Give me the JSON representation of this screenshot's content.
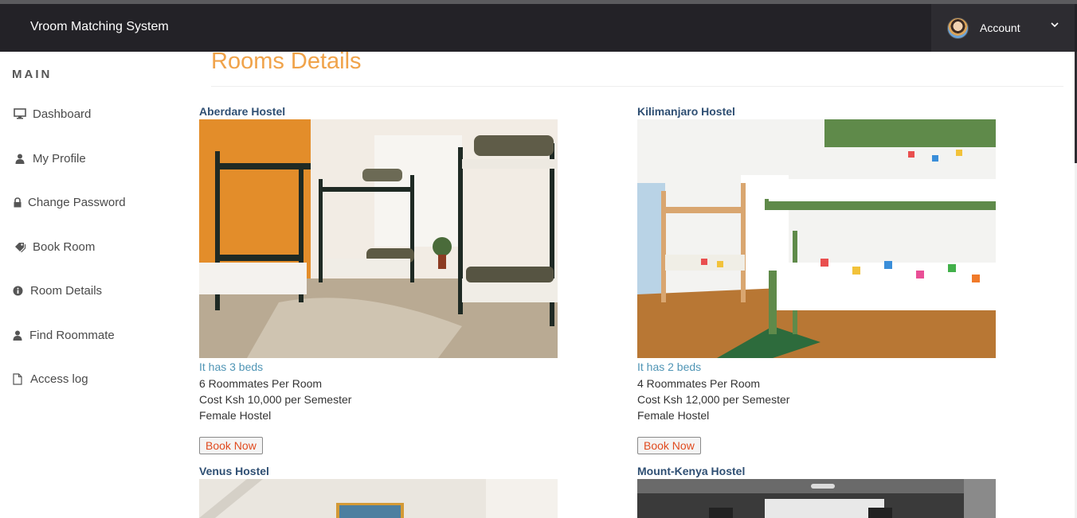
{
  "app": {
    "title": "Vroom Matching System"
  },
  "account": {
    "label": "Account",
    "icon": "chevron-down-icon"
  },
  "sidebar": {
    "heading": "MAIN",
    "items": [
      {
        "label": "Dashboard",
        "icon": "monitor-icon"
      },
      {
        "label": "My Profile",
        "icon": "user-icon"
      },
      {
        "label": "Change Password",
        "icon": "lock-icon"
      },
      {
        "label": "Book Room",
        "icon": "tag-icon"
      },
      {
        "label": "Room Details",
        "icon": "info-icon"
      },
      {
        "label": "Find Roommate",
        "icon": "user-icon"
      },
      {
        "label": "Access log",
        "icon": "file-icon"
      }
    ]
  },
  "main": {
    "title": "Rooms Details",
    "hostels": [
      {
        "name": "Aberdare Hostel",
        "beds": "It has 3 beds",
        "roommates": "6 Roommates Per Room",
        "cost": "Cost Ksh 10,000 per Semester",
        "type": "Female Hostel",
        "button": "Book Now"
      },
      {
        "name": "Kilimanjaro Hostel",
        "beds": "It has 2 beds",
        "roommates": "4 Roommates Per Room",
        "cost": "Cost Ksh 12,000 per Semester",
        "type": "Female Hostel",
        "button": "Book Now"
      },
      {
        "name": "Venus Hostel"
      },
      {
        "name": "Mount-Kenya Hostel"
      }
    ]
  },
  "colors": {
    "navbar": "#232227",
    "title": "#f0a34a",
    "hostel_name": "#2f4f73",
    "beds": "#4f95b5",
    "button_text": "#e04a1e"
  }
}
